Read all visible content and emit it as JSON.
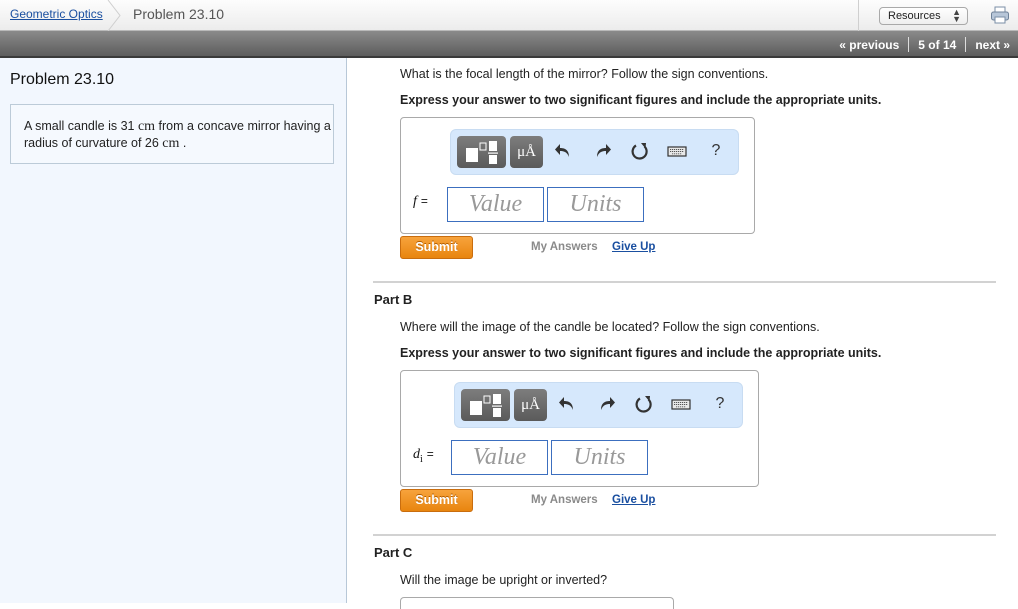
{
  "header": {
    "breadcrumb_link": "Geometric Optics",
    "breadcrumb_current": "Problem 23.10",
    "resources_select": "Resources",
    "print_icon": "printer-icon"
  },
  "nav": {
    "previous": "« previous",
    "position": "5 of 14",
    "next": "next »"
  },
  "sidebar": {
    "title": "Problem 23.10",
    "statement": {
      "pre": "A small candle is 31 ",
      "unit1": "cm",
      "mid": " from a concave mirror having a radius of curvature of 26 ",
      "unit2": "cm",
      "post": " ."
    }
  },
  "toolbar": {
    "templates_icon": "templates-icon",
    "units_label": "μÅ",
    "undo_icon": "undo-icon",
    "redo_icon": "redo-icon",
    "reset_icon": "reset-icon",
    "keyboard_icon": "keyboard-icon",
    "help_label": "?"
  },
  "parts": [
    {
      "title": "",
      "question": "What is the focal length of the mirror? Follow the sign conventions.",
      "instruction": "Express your answer to two significant figures and include the appropriate units.",
      "variable": "f",
      "variable_sub": "",
      "equals": "=",
      "value_placeholder": "Value",
      "units_placeholder": "Units",
      "submit": "Submit",
      "my_answers": "My Answers",
      "give_up": "Give Up"
    },
    {
      "title": "Part B",
      "question": "Where will the image of the candle be located? Follow the sign conventions.",
      "instruction": "Express your answer to two significant figures and include the appropriate units.",
      "variable": "d",
      "variable_sub": "i",
      "equals": "=",
      "value_placeholder": "Value",
      "units_placeholder": "Units",
      "submit": "Submit",
      "my_answers": "My Answers",
      "give_up": "Give Up"
    },
    {
      "title": "Part C",
      "question": "Will the image be upright or inverted?"
    }
  ],
  "colors": {
    "link": "#1a4fa0",
    "submit": "#e8850f",
    "toolbar_bg": "#d6e8fc",
    "sidebar_bg": "#f2f7fe",
    "field_border": "#3c6fbf"
  }
}
